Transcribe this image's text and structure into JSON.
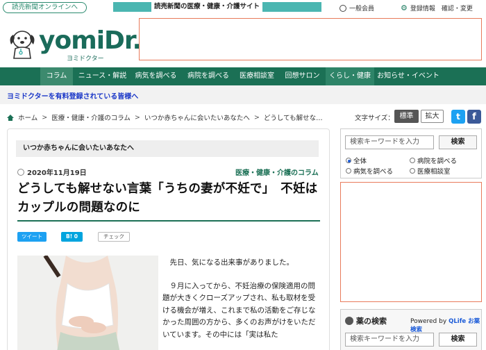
{
  "topbar": {
    "online_label": "読売新聞オンラインへ",
    "tagline": "読売新聞の医療・健康・介護サイト",
    "member_label": "一般会員",
    "register_label": "登録情報　確認・変更"
  },
  "logo": {
    "text": "yomiDr.",
    "sub": "ヨミドクター"
  },
  "nav": {
    "items": [
      "コラム",
      "ニュース・解説",
      "病気を調べる",
      "病院を調べる",
      "医療相談室",
      "回想サロン",
      "くらし・健康",
      "お知らせ・イベント"
    ]
  },
  "notice": "ヨミドクターを有料登録されている皆様へ",
  "breadcrumb": [
    "ホーム",
    "医療・健康・介護のコラム",
    "いつか赤ちゃんに会いたいあなたへ",
    "どうしても解せな…"
  ],
  "fontsize": {
    "label": "文字サイズ：",
    "standard": "標準",
    "large": "拡大"
  },
  "social": {
    "twitter": "t",
    "facebook": "f"
  },
  "article": {
    "series": "いつか赤ちゃんに会いたいあなたへ",
    "date": "2020年11月19日",
    "category": "医療・健康・介護のコラム",
    "title": "どうしても解せない言葉「うちの妻が不妊で」　不妊はカップルの問題なのに",
    "share_tweet": "ツイート",
    "share_hatena": "B! 0",
    "share_check": "チェック",
    "paragraphs": [
      "　先日、気になる出来事がありました。",
      "　９月に入ってから、不妊治療の保険適用の問題が大きくクローズアップされ、私も取材を受ける機会が増え、これまで私の活動をご存じなかった周囲の方から、多くのお声がけをいただいています。その中には「実は私た"
    ]
  },
  "sidebar": {
    "search_placeholder": "検索キーワードを入力",
    "search_button": "検索",
    "radios": [
      "全体",
      "病院を調べる",
      "病気を調べる",
      "医療相談室"
    ],
    "selected_radio": "全体",
    "drug_title": "薬の検索",
    "drug_powered": "Powered by",
    "drug_brand": "QLife お薬検索",
    "drug_placeholder": "検索キーワードを入力",
    "drug_button": "検索"
  },
  "colors": {
    "brand_green": "#1b7055",
    "accent_teal": "#4bb6b1",
    "ad_border": "#e87a5a",
    "link_blue": "#1a37c8"
  }
}
